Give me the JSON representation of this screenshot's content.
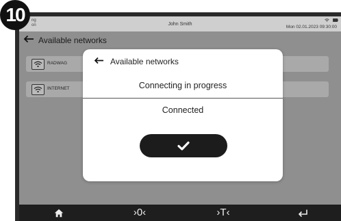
{
  "step_badge": "10",
  "status_bar": {
    "left_fragment": "ng\non",
    "user": "John Smith",
    "datetime": "Mon 02.01.2023   09:30:00",
    "icons": [
      "wifi-icon",
      "battery-icon"
    ]
  },
  "header": {
    "title": "Available networks",
    "back_icon": "arrow-left-icon"
  },
  "networks": [
    {
      "label": "RADWAG",
      "icon": "wifi-icon"
    },
    {
      "label": "INTERNET",
      "icon": "wifi-icon"
    }
  ],
  "modal": {
    "title": "Available networks",
    "subtitle": "Connecting in progress",
    "status": "Connected",
    "confirm_icon": "checkmark-icon"
  },
  "bottom_nav": [
    {
      "icon": "home-icon",
      "glyph": "🏠"
    },
    {
      "icon": "zero-icon",
      "glyph": "›0‹"
    },
    {
      "icon": "tare-icon",
      "glyph": "›T‹"
    },
    {
      "icon": "enter-icon",
      "glyph": "↵"
    }
  ],
  "colors": {
    "overlay": "#8f8f8f",
    "modal_bg": "#ffffff",
    "button_bg": "#1c1c1c",
    "nav_bg": "#1e1e1e"
  }
}
